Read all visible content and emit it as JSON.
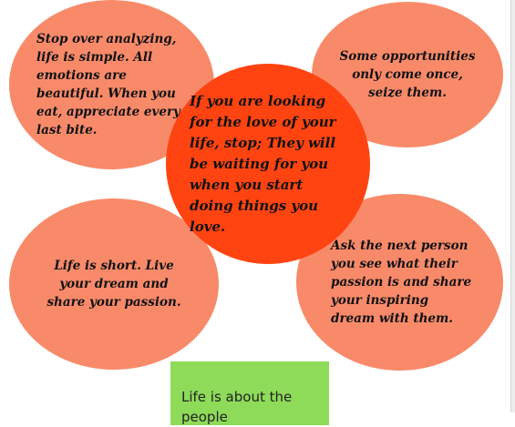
{
  "colors": {
    "bubble_light": "#f88a6a",
    "bubble_center": "#ff4412",
    "note_green": "#8edb5a"
  },
  "bubbles": [
    {
      "text": "Stop over analyzing, life is simple. All emotions are beautiful. When you eat, appreciate every last bite."
    },
    {
      "text": "Some opportunities only come once, seize them."
    },
    {
      "text": "If you are looking for the love of your life, stop; They will be waiting for you when you start doing things you love."
    },
    {
      "text": "Life is short. Live your dream and share your passion."
    },
    {
      "text": "Ask the next person you see what their passion is and share your inspiring dream with them."
    }
  ],
  "note": {
    "text": "Life is about the people"
  }
}
